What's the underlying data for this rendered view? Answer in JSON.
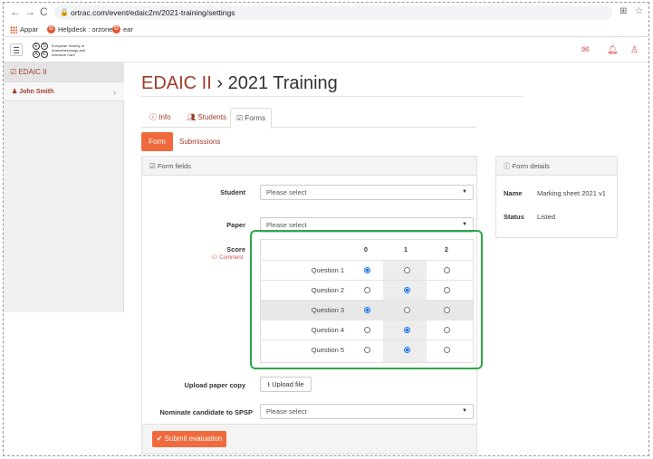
{
  "browser": {
    "url": "ortrac.com/event/edaic2m/2021-training/settings",
    "bookmarks": [
      {
        "label": "Appar"
      },
      {
        "label": "Helpdesk : orzone"
      },
      {
        "label": "ear"
      }
    ]
  },
  "header": {
    "logo_letters": [
      "E",
      "S",
      "A",
      "IC"
    ],
    "logo_text": "European Society of Anaesthesiology and Intensive Care"
  },
  "sidebar": {
    "items": [
      {
        "label": "EDAIC II",
        "active": true
      },
      {
        "label": "John Smith",
        "chevron": "›"
      }
    ]
  },
  "page": {
    "title_link": "EDAIC II",
    "title_sep": " › ",
    "title_rest": "2021 Training"
  },
  "tabs": [
    {
      "label": "Info"
    },
    {
      "label": "Students"
    },
    {
      "label": "Forms",
      "active": true
    }
  ],
  "subtabs": {
    "form": "Form",
    "submissions": "Submissions"
  },
  "form_panel": {
    "heading": "Form fields",
    "student_label": "Student",
    "student_value": "Please select",
    "paper_label": "Paper",
    "paper_value": "Please select",
    "score_label": "Score",
    "comment_link": "Comment",
    "score_columns": [
      "0",
      "1",
      "2"
    ],
    "questions": [
      {
        "label": "Question 1",
        "selected": 0
      },
      {
        "label": "Question 2",
        "selected": 1
      },
      {
        "label": "Question 3",
        "selected": 0
      },
      {
        "label": "Question 4",
        "selected": 1
      },
      {
        "label": "Question 5",
        "selected": 1
      }
    ],
    "upload_label": "Upload paper copy",
    "upload_button": "Upload file",
    "nominate_label": "Nominate candidate to SPSP",
    "nominate_value": "Please select",
    "submit_button": "Submit evaluation"
  },
  "details_panel": {
    "heading": "Form details",
    "name_label": "Name",
    "name_value": "Marking sheet 2021 v1",
    "status_label": "Status",
    "status_value": "Listed"
  },
  "colors": {
    "accent": "#f06a3d",
    "link": "#a03b2a",
    "highlight_box": "#2aa84a",
    "radio_checked": "#1a73e8"
  }
}
